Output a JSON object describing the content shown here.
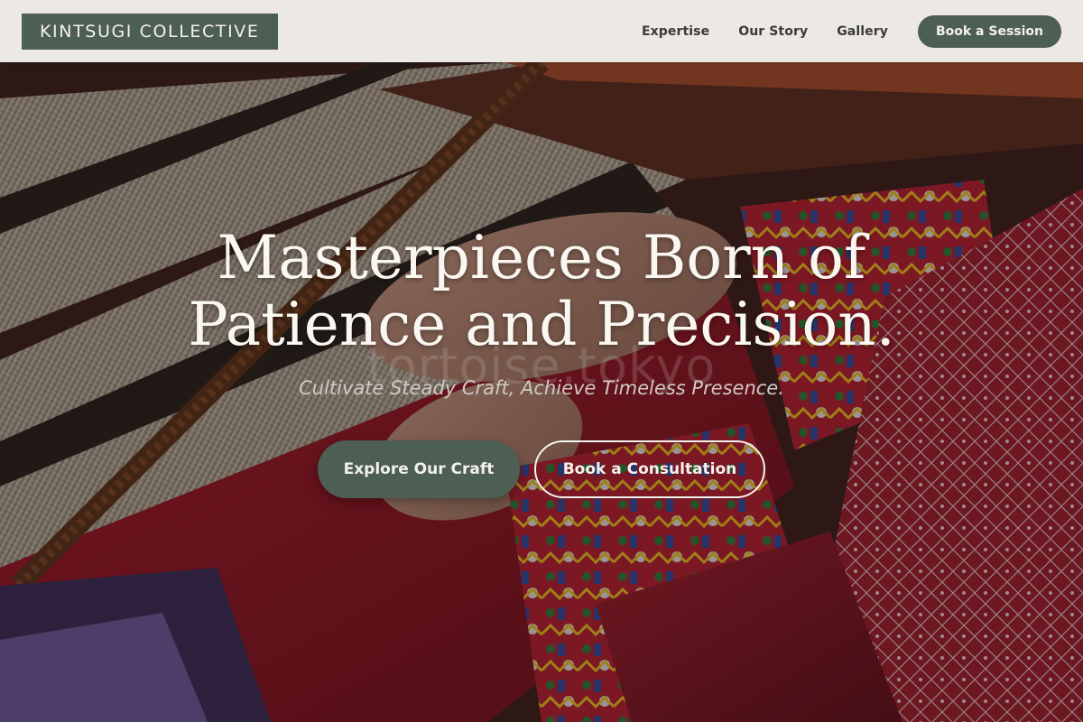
{
  "header": {
    "brand": "KINTSUGI COLLECTIVE",
    "nav": [
      {
        "label": "Expertise"
      },
      {
        "label": "Our Story"
      },
      {
        "label": "Gallery"
      }
    ],
    "cta_label": "Book a Session"
  },
  "hero": {
    "title_line1": "Masterpieces Born of",
    "title_line2": "Patience and Precision.",
    "subtitle": "Cultivate Steady Craft, Achieve Timeless Presence.",
    "watermark": "tortoise.tokyo",
    "primary_button": "Explore Our Craft",
    "secondary_button": "Book a Consultation",
    "background_image": "weaving-loom-textile-photo"
  },
  "colors": {
    "brand_green": "#4d5e52",
    "header_bg": "#ece9e4",
    "hero_text": "#faf7f1"
  }
}
